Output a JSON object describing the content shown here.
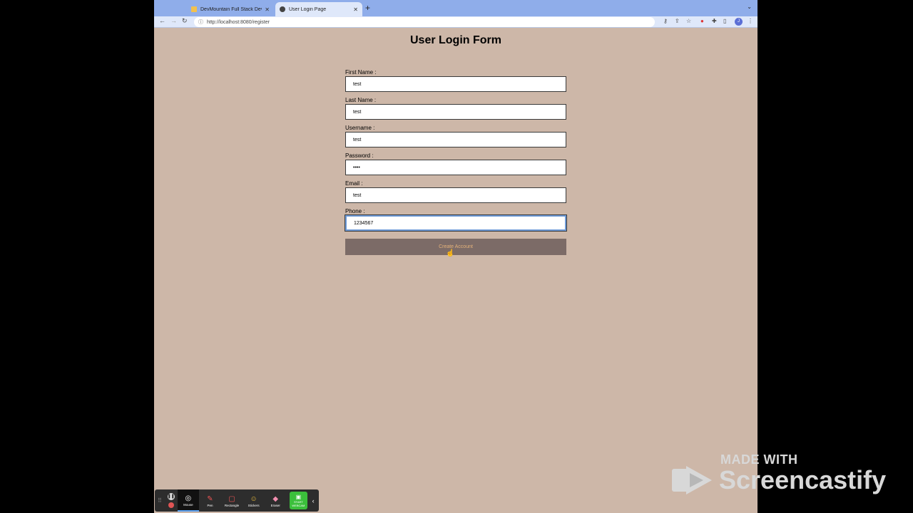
{
  "browser": {
    "tabs": [
      {
        "title": "DevMountain Full Stack Develo",
        "active": false
      },
      {
        "title": "User Login Page",
        "active": true
      }
    ],
    "url": "http://localhost:8080/register"
  },
  "page": {
    "title": "User Login Form",
    "fields": [
      {
        "label": "First Name :",
        "value": "test"
      },
      {
        "label": "Last Name :",
        "value": "test"
      },
      {
        "label": "Username :",
        "value": "test"
      },
      {
        "label": "Password :",
        "value": "••••"
      },
      {
        "label": "Email :",
        "value": "test"
      },
      {
        "label": "Phone :",
        "value": "1234567"
      }
    ],
    "submit_label": "Create Account"
  },
  "screencastify": {
    "tools": [
      "Mouse",
      "Pen",
      "Rectangle",
      "Stickers",
      "Eraser"
    ],
    "webcam_label": "START WEBCAM",
    "watermark_top": "MADE WITH",
    "watermark_brand": "Screencastify"
  },
  "colors": {
    "page_bg": "#cdb7a8",
    "button_bg": "#7c6b67",
    "button_text": "#e4b27a",
    "tabstrip": "#8fadea"
  }
}
